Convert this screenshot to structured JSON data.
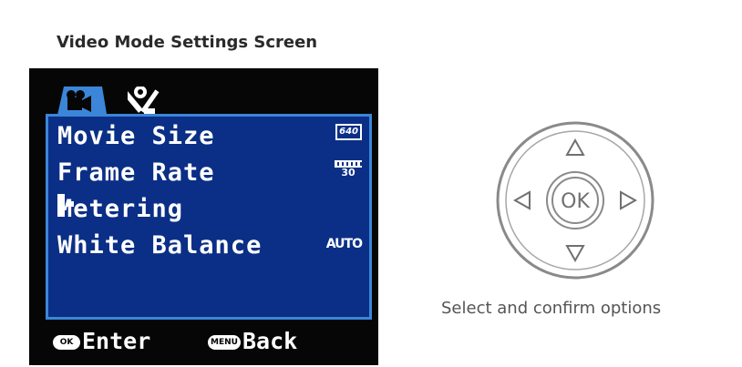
{
  "caption": {
    "title": "Video Mode Settings Screen"
  },
  "tabs": [
    {
      "name": "video",
      "icon": "video-camera-icon"
    },
    {
      "name": "setup",
      "icon": "tools-icon"
    }
  ],
  "menu": {
    "items": [
      {
        "label": "Movie Size",
        "value": "640",
        "icon": "resolution-640-icon"
      },
      {
        "label": "Frame Rate",
        "value": "30",
        "icon": "frame-rate-icon"
      },
      {
        "label": "Metering",
        "value": "",
        "icon": "center-metering-icon"
      },
      {
        "label": "White Balance",
        "value": "AUTO",
        "icon": "white-balance-auto-icon"
      }
    ]
  },
  "footer": {
    "enter_badge": "OK",
    "enter_label": "Enter",
    "back_badge": "MENU",
    "back_label": "Back"
  },
  "dpad": {
    "center_label": "OK",
    "caption": "Select and confirm options"
  },
  "colors": {
    "screen_bg": "#060606",
    "menu_bg": "#0b2f86",
    "menu_border": "#3b86d8",
    "caption_text": "#555555"
  }
}
